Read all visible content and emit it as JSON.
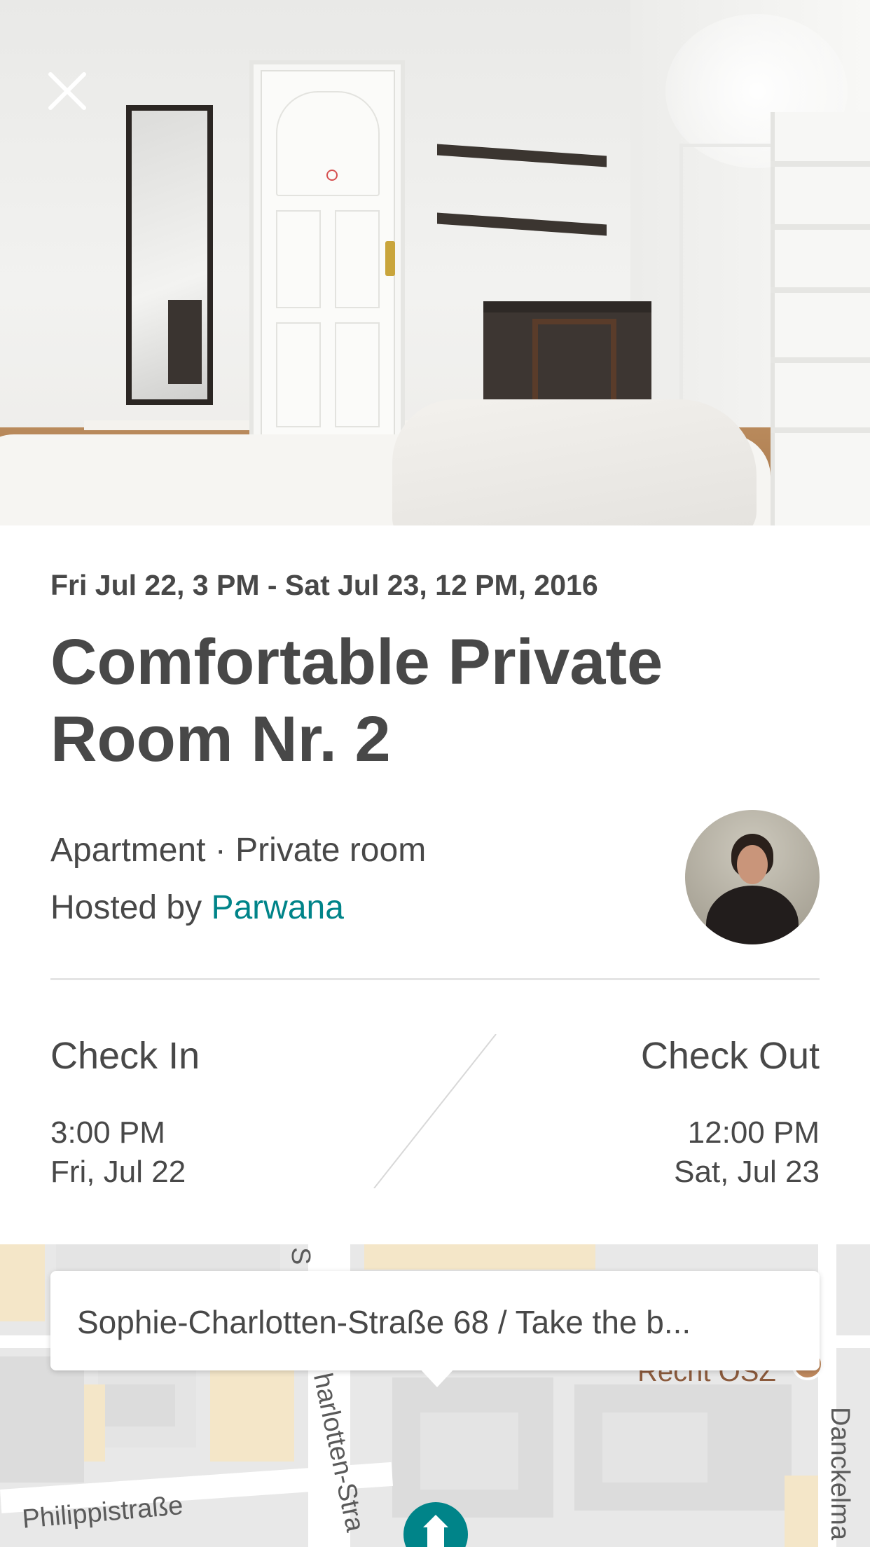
{
  "listing": {
    "date_range": "Fri Jul 22, 3 PM - Sat Jul 23, 12 PM, 2016",
    "title": "Comfortable Private Room Nr. 2",
    "room_type": "Apartment · Private room",
    "hosted_by_prefix": "Hosted by ",
    "host_name": "Parwana"
  },
  "check_in": {
    "label": "Check In",
    "time": "3:00 PM",
    "date": "Fri, Jul 22"
  },
  "check_out": {
    "label": "Check Out",
    "time": "12:00 PM",
    "date": "Sat, Jul 23"
  },
  "map": {
    "address_callout": "Sophie-Charlotten-Straße 68 / Take the b...",
    "streets": {
      "philippistrasse": "Philippistraße",
      "sophie_charlotten": "harlotten-Stra",
      "sophie_charlotten_top": "S",
      "danckelmann": "Danckelma"
    },
    "poi": "Recht OSZ"
  },
  "icons": {
    "close": "close-icon",
    "home_pin": "home-icon"
  },
  "colors": {
    "text": "#484848",
    "link": "#008489",
    "pin": "#008489"
  }
}
